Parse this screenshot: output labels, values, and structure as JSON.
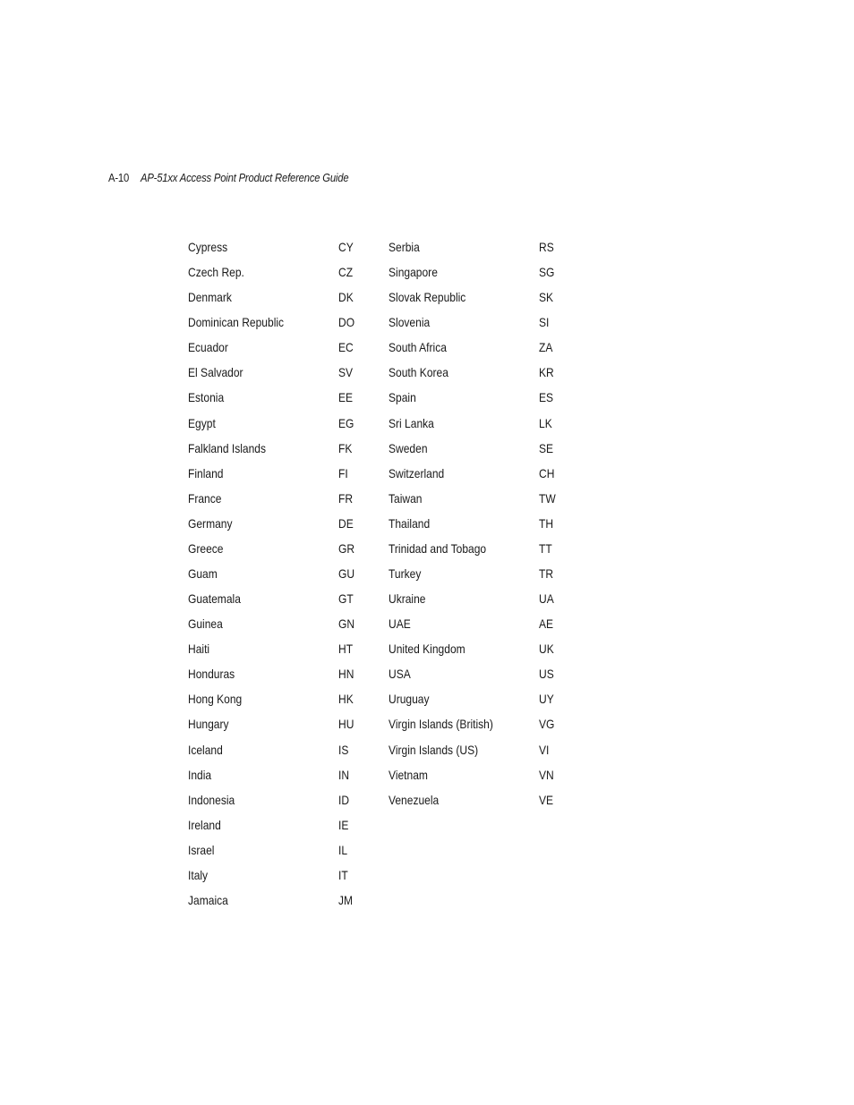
{
  "header": {
    "page_number": "A-10",
    "title": "AP-51xx Access Point Product Reference Guide"
  },
  "country_table": {
    "left_column": [
      {
        "country": "Cypress",
        "code": "CY"
      },
      {
        "country": "Czech Rep.",
        "code": "CZ"
      },
      {
        "country": "Denmark",
        "code": "DK"
      },
      {
        "country": "Dominican Republic",
        "code": "DO"
      },
      {
        "country": "Ecuador",
        "code": "EC"
      },
      {
        "country": "El Salvador",
        "code": "SV"
      },
      {
        "country": "Estonia",
        "code": "EE"
      },
      {
        "country": "Egypt",
        "code": "EG"
      },
      {
        "country": "Falkland Islands",
        "code": "FK"
      },
      {
        "country": "Finland",
        "code": "FI"
      },
      {
        "country": "France",
        "code": "FR"
      },
      {
        "country": "Germany",
        "code": "DE"
      },
      {
        "country": "Greece",
        "code": "GR"
      },
      {
        "country": "Guam",
        "code": "GU"
      },
      {
        "country": "Guatemala",
        "code": "GT"
      },
      {
        "country": "Guinea",
        "code": "GN"
      },
      {
        "country": "Haiti",
        "code": "HT"
      },
      {
        "country": "Honduras",
        "code": "HN"
      },
      {
        "country": "Hong Kong",
        "code": "HK"
      },
      {
        "country": "Hungary",
        "code": "HU"
      },
      {
        "country": "Iceland",
        "code": "IS"
      },
      {
        "country": "India",
        "code": "IN"
      },
      {
        "country": "Indonesia",
        "code": "ID"
      },
      {
        "country": "Ireland",
        "code": "IE"
      },
      {
        "country": "Israel",
        "code": "IL"
      },
      {
        "country": "Italy",
        "code": "IT"
      },
      {
        "country": "Jamaica",
        "code": "JM"
      }
    ],
    "right_column": [
      {
        "country": "Serbia",
        "code": "RS"
      },
      {
        "country": "Singapore",
        "code": "SG"
      },
      {
        "country": "Slovak Republic",
        "code": "SK"
      },
      {
        "country": "Slovenia",
        "code": "SI"
      },
      {
        "country": "South Africa",
        "code": "ZA"
      },
      {
        "country": "South Korea",
        "code": "KR"
      },
      {
        "country": "Spain",
        "code": "ES"
      },
      {
        "country": "Sri Lanka",
        "code": "LK"
      },
      {
        "country": "Sweden",
        "code": "SE"
      },
      {
        "country": "Switzerland",
        "code": "CH"
      },
      {
        "country": "Taiwan",
        "code": "TW"
      },
      {
        "country": "Thailand",
        "code": "TH"
      },
      {
        "country": "Trinidad and Tobago",
        "code": "TT"
      },
      {
        "country": "Turkey",
        "code": "TR"
      },
      {
        "country": "Ukraine",
        "code": "UA"
      },
      {
        "country": "UAE",
        "code": "AE"
      },
      {
        "country": "United Kingdom",
        "code": "UK"
      },
      {
        "country": "USA",
        "code": "US"
      },
      {
        "country": "Uruguay",
        "code": "UY"
      },
      {
        "country": "Virgin Islands (British)",
        "code": "VG"
      },
      {
        "country": "Virgin Islands (US)",
        "code": "VI"
      },
      {
        "country": "Vietnam",
        "code": "VN"
      },
      {
        "country": "Venezuela",
        "code": "VE"
      }
    ]
  }
}
